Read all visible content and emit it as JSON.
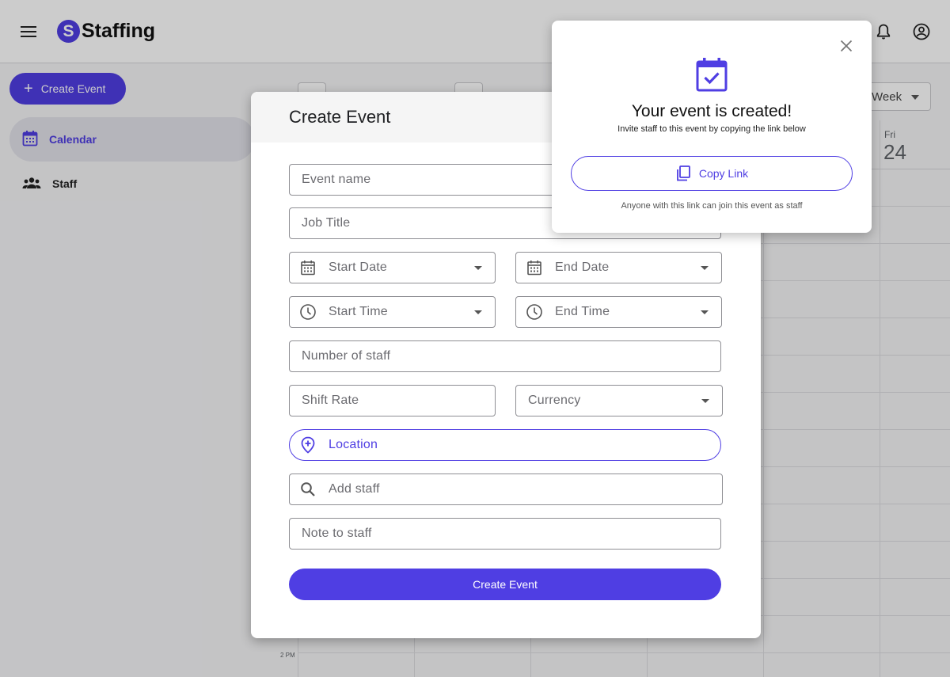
{
  "app": {
    "logo_letter": "S",
    "name": "Staffing",
    "menu_icon": "hamburger-menu-icon",
    "notifications_icon": "bell-icon",
    "account_icon": "account-circle-icon"
  },
  "sidebar": {
    "create_button": "Create Event",
    "items": [
      {
        "label": "Calendar",
        "icon": "calendar-icon",
        "active": true
      },
      {
        "label": "Staff",
        "icon": "people-icon",
        "active": false
      }
    ]
  },
  "calendar": {
    "view": "Week",
    "visible_day": {
      "name": "Fri",
      "number": "24"
    },
    "time_label": "2 PM"
  },
  "create_event_form": {
    "title": "Create Event",
    "fields": {
      "event_name": "Event name",
      "job_title": "Job Title",
      "start_date": "Start Date",
      "end_date": "End Date",
      "start_time": "Start Time",
      "end_time": "End Time",
      "number_of_staff": "Number of staff",
      "shift_rate": "Shift Rate",
      "currency": "Currency",
      "location": "Location",
      "add_staff": "Add staff",
      "note_to_staff": "Note to staff"
    },
    "submit_label": "Create Event"
  },
  "success_popup": {
    "title": "Your event is created!",
    "subtitle": "Invite staff to this event by copying the link below",
    "copy_button": "Copy Link",
    "note": "Anyone with this link can join this event as staff"
  },
  "colors": {
    "accent": "#4f3ee3",
    "scrim": "rgba(0,0,0,0.2)"
  }
}
